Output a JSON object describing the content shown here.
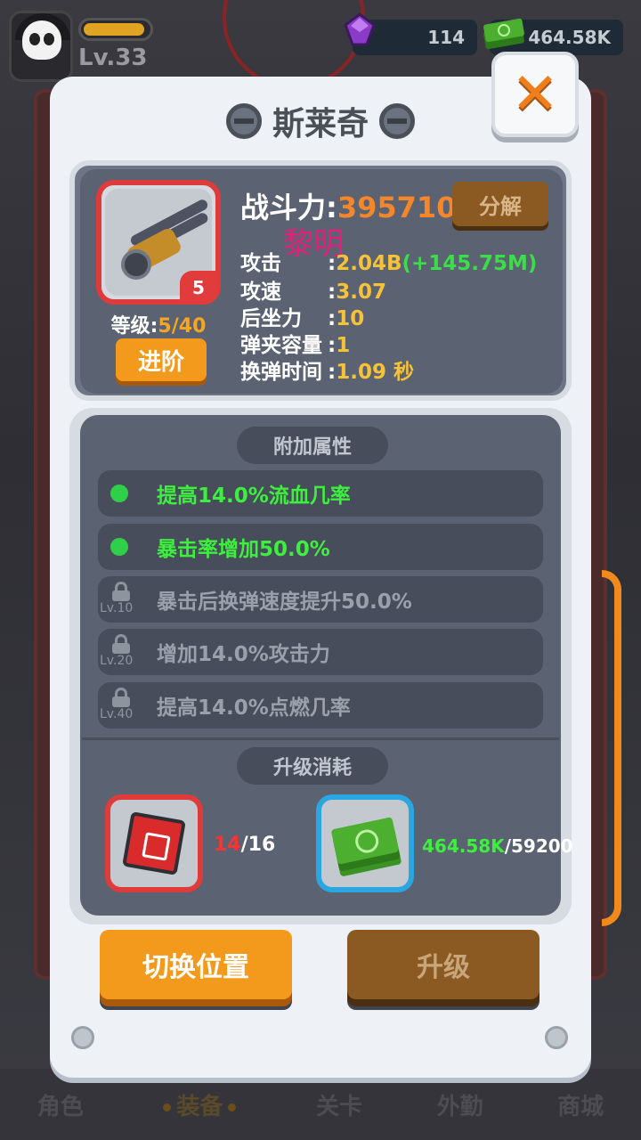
{
  "hud": {
    "level": "Lv.33",
    "xp_fraction": 0.95,
    "gems": "114",
    "cash": "464.58K"
  },
  "modal": {
    "title": "斯莱奇",
    "close_glyph": "✕"
  },
  "weapon": {
    "rarity_level": "5",
    "grade_label": "等级:",
    "grade_value": "5/40",
    "advance_label": "进阶",
    "power_label": "战斗力:",
    "power_value": "395710",
    "decompose_label": "分解",
    "watermark": "黎明",
    "stats": [
      {
        "label": "攻击",
        "sep": ":",
        "value": "2.04B",
        "bonus": "(+145.75M)"
      },
      {
        "label": "攻速",
        "sep": ":",
        "value": "3.07"
      },
      {
        "label": "后坐力",
        "sep": ":",
        "value": "10"
      },
      {
        "label": "弹夹容量",
        "sep": ":",
        "value": "1"
      },
      {
        "label": "换弹时间",
        "sep": ":",
        "value": "1.09 秒"
      }
    ]
  },
  "affixes": {
    "header": "附加属性",
    "items": [
      {
        "text": "提高14.0%流血几率",
        "locked": false
      },
      {
        "text": "暴击率增加50.0%",
        "locked": false
      },
      {
        "text": "暴击后换弹速度提升50.0%",
        "locked": true,
        "lock_level": "Lv.10"
      },
      {
        "text": "增加14.0%攻击力",
        "locked": true,
        "lock_level": "Lv.20"
      },
      {
        "text": "提高14.0%点燃几率",
        "locked": true,
        "lock_level": "Lv.40"
      }
    ]
  },
  "upgrade_cost": {
    "header": "升级消耗",
    "chip_have": "14",
    "chip_need": "/16",
    "cash_have": "464.58K",
    "cash_need": "/59200"
  },
  "buttons": {
    "swap": "切换位置",
    "upgrade": "升级"
  },
  "bottom_nav": [
    "角色",
    "装备",
    "关卡",
    "外勤",
    "商城"
  ],
  "colors": {
    "accent_orange": "#f39a1d",
    "rarity_red": "#de3b3b",
    "bonus_green": "#3ef03e",
    "stat_yellow": "#f5c23a"
  }
}
